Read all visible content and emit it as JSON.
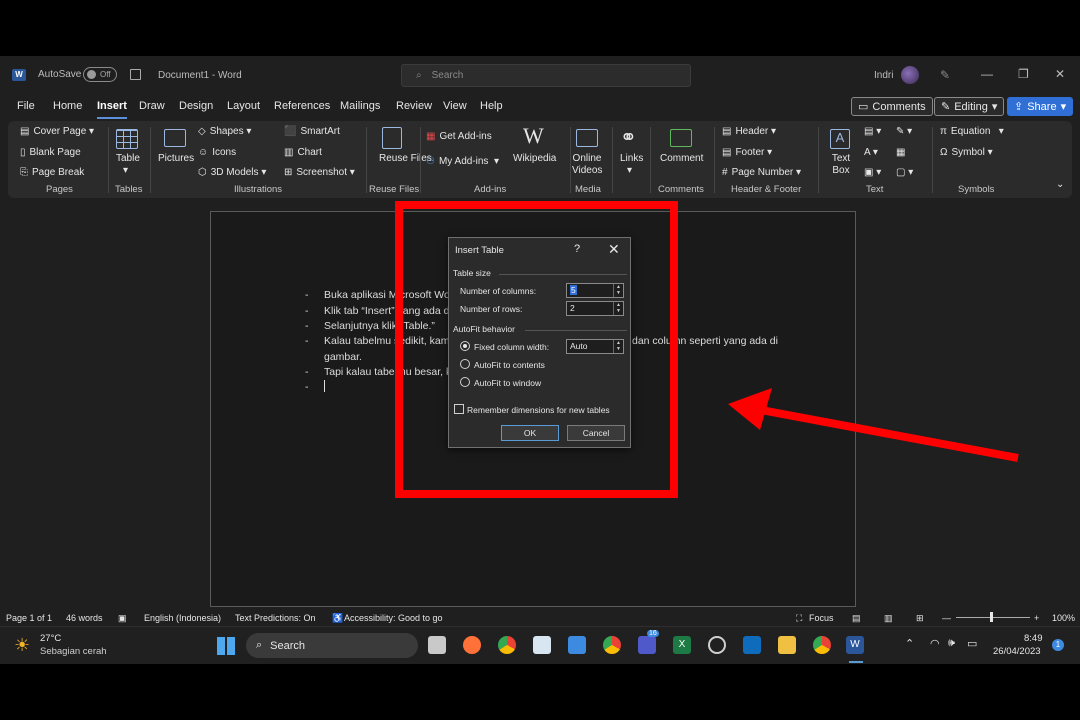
{
  "titlebar": {
    "autosave_label": "AutoSave",
    "toggle_state": "Off",
    "doc_title": "Document1  -  Word",
    "search_placeholder": "Search",
    "user_name": "Indri"
  },
  "tabs": [
    "File",
    "Home",
    "Insert",
    "Draw",
    "Design",
    "Layout",
    "References",
    "Mailings",
    "Review",
    "View",
    "Help"
  ],
  "active_tab": "Insert",
  "actions": {
    "comments": "Comments",
    "editing": "Editing",
    "share": "Share"
  },
  "ribbon": {
    "pages": {
      "cover_page": "Cover Page",
      "blank_page": "Blank Page",
      "page_break": "Page Break",
      "group": "Pages"
    },
    "tables": {
      "table": "Table",
      "group": "Tables"
    },
    "illustrations": {
      "pictures": "Pictures",
      "shapes": "Shapes",
      "icons": "Icons",
      "models3d": "3D Models",
      "smartart": "SmartArt",
      "chart": "Chart",
      "screenshot": "Screenshot",
      "group": "Illustrations"
    },
    "reuse": {
      "reuse_files": "Reuse Files",
      "group": "Reuse Files"
    },
    "addins": {
      "get_addins": "Get Add-ins",
      "my_addins": "My Add-ins",
      "wikipedia": "Wikipedia",
      "group": "Add-ins"
    },
    "media": {
      "online_videos": "Online Videos",
      "group": "Media"
    },
    "links": {
      "links": "Links"
    },
    "comments": {
      "comment": "Comment",
      "group": "Comments"
    },
    "header_footer": {
      "header": "Header",
      "footer": "Footer",
      "page_number": "Page Number",
      "group": "Header & Footer"
    },
    "text": {
      "text_box": "Text Box",
      "group": "Text"
    },
    "symbols": {
      "equation": "Equation",
      "symbol": "Symbol",
      "group": "Symbols"
    }
  },
  "document": {
    "lines": [
      "Buka aplikasi Microsoft Wo",
      "Klik tab “Insert” yang ada d",
      "Selanjutnya klik “Table.”",
      "Kalau tabelmu sedikit, kam",
      "gambar.",
      "Tapi kalau tabelmu besar, k"
    ],
    "line4_tail": "dan column seperti yang ada di"
  },
  "dialog": {
    "title": "Insert Table",
    "help": "?",
    "section_size": "Table size",
    "columns_label": "Number of columns:",
    "columns_value": "5",
    "rows_label": "Number of rows:",
    "rows_value": "2",
    "section_autofit": "AutoFit behavior",
    "fixed_label": "Fixed column width:",
    "fixed_value": "Auto",
    "autofit_contents": "AutoFit to contents",
    "autofit_window": "AutoFit to window",
    "remember": "Remember dimensions for new tables",
    "ok": "OK",
    "cancel": "Cancel"
  },
  "statusbar": {
    "page": "Page 1 of 1",
    "words": "46 words",
    "language": "English (Indonesia)",
    "predictions": "Text Predictions: On",
    "accessibility": "Accessibility: Good to go",
    "focus": "Focus",
    "zoom": "100%"
  },
  "taskbar": {
    "temperature": "27°C",
    "weather": "Sebagian cerah",
    "search": "Search",
    "time": "8:49",
    "date": "26/04/2023",
    "notification_count": "1",
    "teams_badge": "16"
  },
  "colors": {
    "accent": "#2f6fd6",
    "annotation": "#ff0000",
    "excel": "#1d7a45",
    "word": "#2b579a"
  }
}
